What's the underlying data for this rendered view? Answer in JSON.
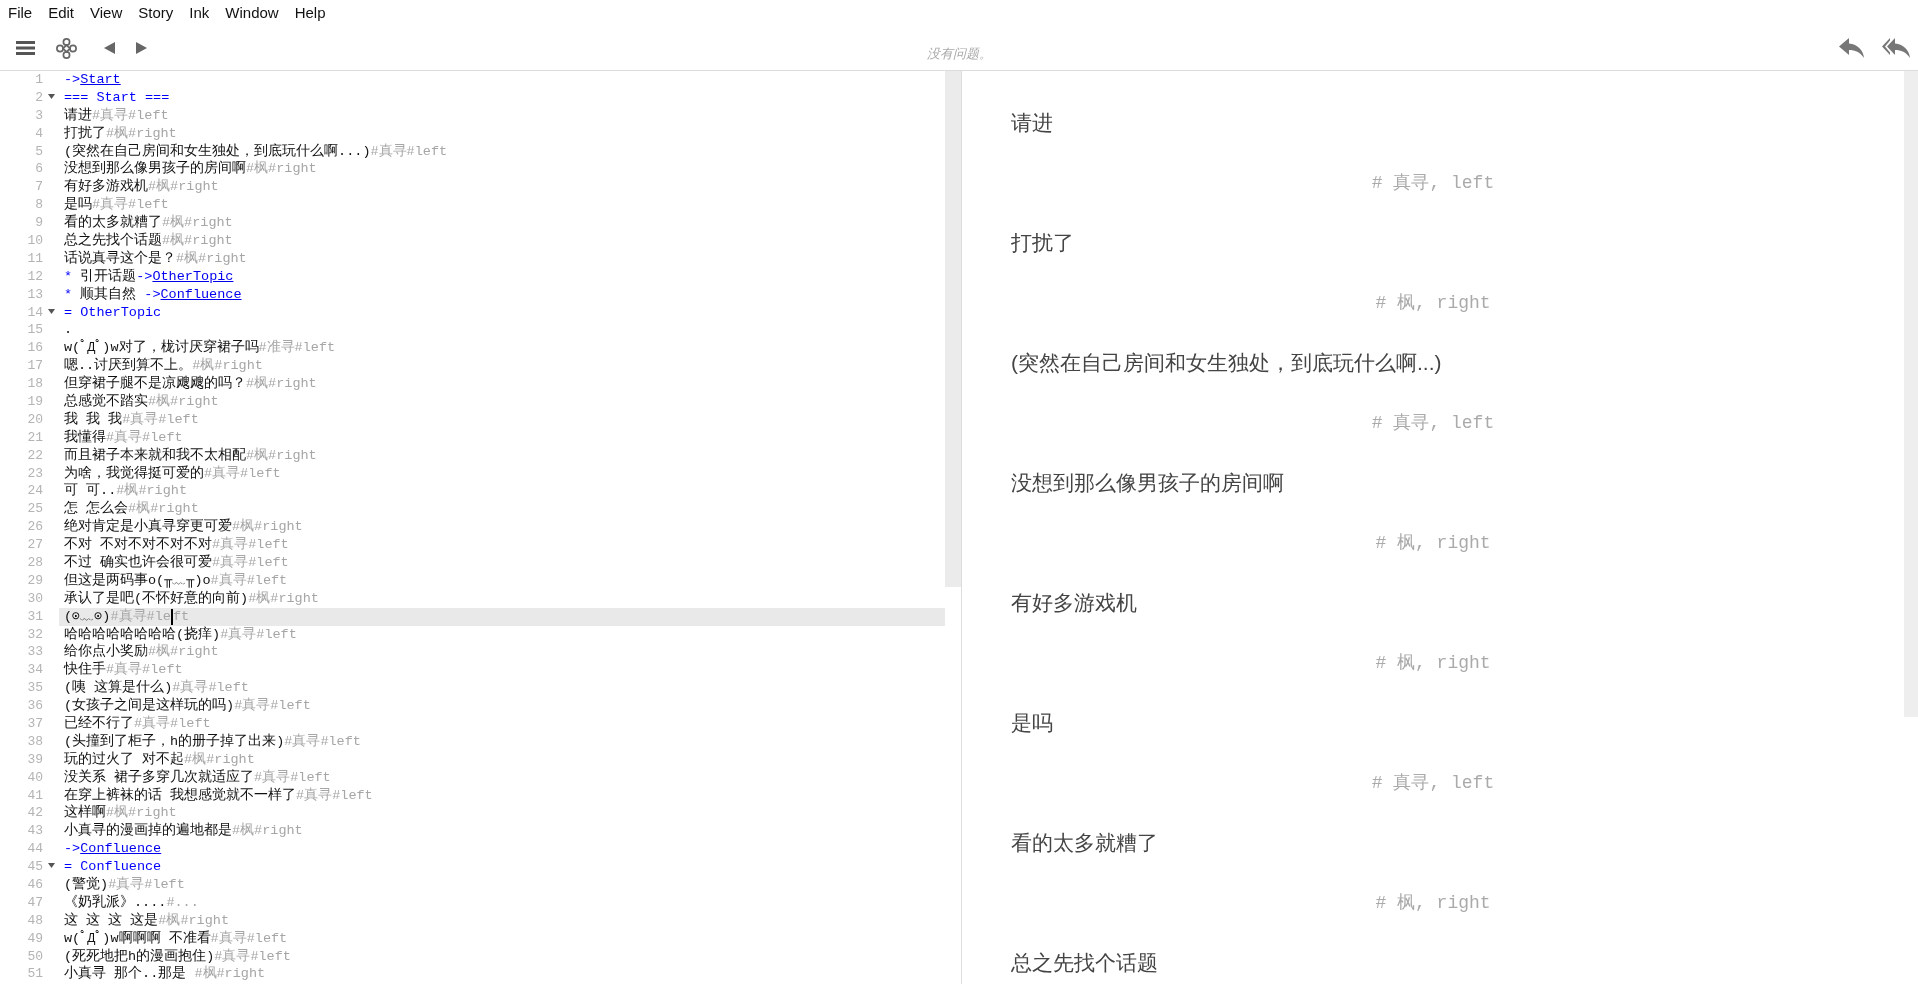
{
  "menu_bar": [
    "File",
    "Edit",
    "View",
    "Story",
    "Ink",
    "Window",
    "Help"
  ],
  "toolbar": {
    "status": "没有问题。"
  },
  "editor": {
    "lines": [
      {
        "number": "1",
        "foldable": false,
        "active": false,
        "segments": [
          {
            "kind": "divert",
            "text": "->"
          },
          {
            "kind": "link",
            "text": "Start"
          }
        ]
      },
      {
        "number": "2",
        "foldable": true,
        "active": false,
        "segments": [
          {
            "kind": "heading",
            "text": "=== Start ==="
          }
        ]
      },
      {
        "number": "3",
        "foldable": false,
        "active": false,
        "segments": [
          {
            "kind": "text",
            "text": "请进"
          },
          {
            "kind": "tag",
            "text": "#真寻#left"
          }
        ]
      },
      {
        "number": "4",
        "foldable": false,
        "active": false,
        "segments": [
          {
            "kind": "text",
            "text": "打扰了"
          },
          {
            "kind": "tag",
            "text": "#枫#right"
          }
        ]
      },
      {
        "number": "5",
        "foldable": false,
        "active": false,
        "segments": [
          {
            "kind": "text",
            "text": "(突然在自己房间和女生独处，到底玩什么啊...)"
          },
          {
            "kind": "tag",
            "text": "#真寻#left"
          }
        ]
      },
      {
        "number": "6",
        "foldable": false,
        "active": false,
        "segments": [
          {
            "kind": "text",
            "text": "没想到那么像男孩子的房间啊"
          },
          {
            "kind": "tag",
            "text": "#枫#right"
          }
        ]
      },
      {
        "number": "7",
        "foldable": false,
        "active": false,
        "segments": [
          {
            "kind": "text",
            "text": "有好多游戏机"
          },
          {
            "kind": "tag",
            "text": "#枫#right"
          }
        ]
      },
      {
        "number": "8",
        "foldable": false,
        "active": false,
        "segments": [
          {
            "kind": "text",
            "text": "是吗"
          },
          {
            "kind": "tag",
            "text": "#真寻#left"
          }
        ]
      },
      {
        "number": "9",
        "foldable": false,
        "active": false,
        "segments": [
          {
            "kind": "text",
            "text": "看的太多就糟了"
          },
          {
            "kind": "tag",
            "text": "#枫#right"
          }
        ]
      },
      {
        "number": "10",
        "foldable": false,
        "active": false,
        "segments": [
          {
            "kind": "text",
            "text": "总之先找个话题"
          },
          {
            "kind": "tag",
            "text": "#枫#right"
          }
        ]
      },
      {
        "number": "11",
        "foldable": false,
        "active": false,
        "segments": [
          {
            "kind": "text",
            "text": "话说真寻这个是？"
          },
          {
            "kind": "tag",
            "text": "#枫#right"
          }
        ]
      },
      {
        "number": "12",
        "foldable": false,
        "active": false,
        "segments": [
          {
            "kind": "choice",
            "text": "*"
          },
          {
            "kind": "text",
            "text": " 引开话题"
          },
          {
            "kind": "divert",
            "text": "->"
          },
          {
            "kind": "link",
            "text": "OtherTopic"
          }
        ]
      },
      {
        "number": "13",
        "foldable": false,
        "active": false,
        "segments": [
          {
            "kind": "choice",
            "text": "*"
          },
          {
            "kind": "text",
            "text": " 顺其自然 "
          },
          {
            "kind": "divert",
            "text": "->"
          },
          {
            "kind": "link",
            "text": "Confluence"
          }
        ]
      },
      {
        "number": "14",
        "foldable": true,
        "active": false,
        "segments": [
          {
            "kind": "heading",
            "text": "= OtherTopic"
          }
        ]
      },
      {
        "number": "15",
        "foldable": false,
        "active": false,
        "segments": [
          {
            "kind": "text",
            "text": "."
          }
        ]
      },
      {
        "number": "16",
        "foldable": false,
        "active": false,
        "segments": [
          {
            "kind": "text",
            "text": "w(ﾟДﾟ)w对了，栊讨厌穿裙子吗"
          },
          {
            "kind": "tag",
            "text": "#准寻#left"
          }
        ]
      },
      {
        "number": "17",
        "foldable": false,
        "active": false,
        "segments": [
          {
            "kind": "text",
            "text": "嗯..讨厌到算不上。"
          },
          {
            "kind": "tag",
            "text": "#枫#right"
          }
        ]
      },
      {
        "number": "18",
        "foldable": false,
        "active": false,
        "segments": [
          {
            "kind": "text",
            "text": "但穿裙子腿不是凉飕飕的吗？"
          },
          {
            "kind": "tag",
            "text": "#枫#right"
          }
        ]
      },
      {
        "number": "19",
        "foldable": false,
        "active": false,
        "segments": [
          {
            "kind": "text",
            "text": "总感觉不踏实"
          },
          {
            "kind": "tag",
            "text": "#枫#right"
          }
        ]
      },
      {
        "number": "20",
        "foldable": false,
        "active": false,
        "segments": [
          {
            "kind": "text",
            "text": "我 我 我"
          },
          {
            "kind": "tag",
            "text": "#真寻#left"
          }
        ]
      },
      {
        "number": "21",
        "foldable": false,
        "active": false,
        "segments": [
          {
            "kind": "text",
            "text": "我懂得"
          },
          {
            "kind": "tag",
            "text": "#真寻#left"
          }
        ]
      },
      {
        "number": "22",
        "foldable": false,
        "active": false,
        "segments": [
          {
            "kind": "text",
            "text": "而且裙子本来就和我不太相配"
          },
          {
            "kind": "tag",
            "text": "#枫#right"
          }
        ]
      },
      {
        "number": "23",
        "foldable": false,
        "active": false,
        "segments": [
          {
            "kind": "text",
            "text": "为啥，我觉得挺可爱的"
          },
          {
            "kind": "tag",
            "text": "#真寻#left"
          }
        ]
      },
      {
        "number": "24",
        "foldable": false,
        "active": false,
        "segments": [
          {
            "kind": "text",
            "text": "可 可.."
          },
          {
            "kind": "tag",
            "text": "#枫#right"
          }
        ]
      },
      {
        "number": "25",
        "foldable": false,
        "active": false,
        "segments": [
          {
            "kind": "text",
            "text": "怎 怎么会"
          },
          {
            "kind": "tag",
            "text": "#枫#right"
          }
        ]
      },
      {
        "number": "26",
        "foldable": false,
        "active": false,
        "segments": [
          {
            "kind": "text",
            "text": "绝对肯定是小真寻穿更可爱"
          },
          {
            "kind": "tag",
            "text": "#枫#right"
          }
        ]
      },
      {
        "number": "27",
        "foldable": false,
        "active": false,
        "segments": [
          {
            "kind": "text",
            "text": "不对 不对不对不对不对"
          },
          {
            "kind": "tag",
            "text": "#真寻#left"
          }
        ]
      },
      {
        "number": "28",
        "foldable": false,
        "active": false,
        "segments": [
          {
            "kind": "text",
            "text": "不过 确实也许会很可爱"
          },
          {
            "kind": "tag",
            "text": "#真寻#left"
          }
        ]
      },
      {
        "number": "29",
        "foldable": false,
        "active": false,
        "segments": [
          {
            "kind": "text",
            "text": "但这是两码事o(╥﹏╥)o"
          },
          {
            "kind": "tag",
            "text": "#真寻#left"
          }
        ]
      },
      {
        "number": "30",
        "foldable": false,
        "active": false,
        "segments": [
          {
            "kind": "text",
            "text": "承认了是吧(不怀好意的向前)"
          },
          {
            "kind": "tag",
            "text": "#枫#right"
          }
        ]
      },
      {
        "number": "31",
        "foldable": false,
        "active": true,
        "segments": [
          {
            "kind": "text",
            "text": "(⊙﹏⊙)"
          },
          {
            "kind": "tag",
            "text": "#真寻#le"
          },
          {
            "kind": "cursor"
          },
          {
            "kind": "tag",
            "text": "ft"
          }
        ]
      },
      {
        "number": "32",
        "foldable": false,
        "active": false,
        "segments": [
          {
            "kind": "text",
            "text": "哈哈哈哈哈哈哈哈(挠痒)"
          },
          {
            "kind": "tag",
            "text": "#真寻#left"
          }
        ]
      },
      {
        "number": "33",
        "foldable": false,
        "active": false,
        "segments": [
          {
            "kind": "text",
            "text": "给你点小奖励"
          },
          {
            "kind": "tag",
            "text": "#枫#right"
          }
        ]
      },
      {
        "number": "34",
        "foldable": false,
        "active": false,
        "segments": [
          {
            "kind": "text",
            "text": "快住手"
          },
          {
            "kind": "tag",
            "text": "#真寻#left"
          }
        ]
      },
      {
        "number": "35",
        "foldable": false,
        "active": false,
        "segments": [
          {
            "kind": "text",
            "text": "(咦 这算是什么)"
          },
          {
            "kind": "tag",
            "text": "#真寻#left"
          }
        ]
      },
      {
        "number": "36",
        "foldable": false,
        "active": false,
        "segments": [
          {
            "kind": "text",
            "text": "(女孩子之间是这样玩的吗)"
          },
          {
            "kind": "tag",
            "text": "#真寻#left"
          }
        ]
      },
      {
        "number": "37",
        "foldable": false,
        "active": false,
        "segments": [
          {
            "kind": "text",
            "text": "已经不行了"
          },
          {
            "kind": "tag",
            "text": "#真寻#left"
          }
        ]
      },
      {
        "number": "38",
        "foldable": false,
        "active": false,
        "segments": [
          {
            "kind": "text",
            "text": "(头撞到了柜子，h的册子掉了出来)"
          },
          {
            "kind": "tag",
            "text": "#真寻#left"
          }
        ]
      },
      {
        "number": "39",
        "foldable": false,
        "active": false,
        "segments": [
          {
            "kind": "text",
            "text": "玩的过火了 对不起"
          },
          {
            "kind": "tag",
            "text": "#枫#right"
          }
        ]
      },
      {
        "number": "40",
        "foldable": false,
        "active": false,
        "segments": [
          {
            "kind": "text",
            "text": "没关系 裙子多穿几次就适应了"
          },
          {
            "kind": "tag",
            "text": "#真寻#left"
          }
        ]
      },
      {
        "number": "41",
        "foldable": false,
        "active": false,
        "segments": [
          {
            "kind": "text",
            "text": "在穿上裤袜的话 我想感觉就不一样了"
          },
          {
            "kind": "tag",
            "text": "#真寻#left"
          }
        ]
      },
      {
        "number": "42",
        "foldable": false,
        "active": false,
        "segments": [
          {
            "kind": "text",
            "text": "这样啊"
          },
          {
            "kind": "tag",
            "text": "#枫#right"
          }
        ]
      },
      {
        "number": "43",
        "foldable": false,
        "active": false,
        "segments": [
          {
            "kind": "text",
            "text": "小真寻的漫画掉的遍地都是"
          },
          {
            "kind": "tag",
            "text": "#枫#right"
          }
        ]
      },
      {
        "number": "44",
        "foldable": false,
        "active": false,
        "segments": [
          {
            "kind": "divert",
            "text": "->"
          },
          {
            "kind": "link",
            "text": "Confluence"
          }
        ]
      },
      {
        "number": "45",
        "foldable": true,
        "active": false,
        "segments": [
          {
            "kind": "heading",
            "text": "= Confluence"
          }
        ]
      },
      {
        "number": "46",
        "foldable": false,
        "active": false,
        "segments": [
          {
            "kind": "text",
            "text": "(警觉)"
          },
          {
            "kind": "tag",
            "text": "#真寻#left"
          }
        ]
      },
      {
        "number": "47",
        "foldable": false,
        "active": false,
        "segments": [
          {
            "kind": "text",
            "text": "《奶乳派》...."
          },
          {
            "kind": "tag",
            "text": "#..."
          }
        ]
      },
      {
        "number": "48",
        "foldable": false,
        "active": false,
        "segments": [
          {
            "kind": "text",
            "text": "这 这 这 这是"
          },
          {
            "kind": "tag",
            "text": "#枫#right"
          }
        ]
      },
      {
        "number": "49",
        "foldable": false,
        "active": false,
        "segments": [
          {
            "kind": "text",
            "text": "w(ﾟДﾟ)w啊啊啊 不准看"
          },
          {
            "kind": "tag",
            "text": "#真寻#left"
          }
        ]
      },
      {
        "number": "50",
        "foldable": false,
        "active": false,
        "segments": [
          {
            "kind": "text",
            "text": "(死死地把h的漫画抱住)"
          },
          {
            "kind": "tag",
            "text": "#真寻#left"
          }
        ]
      },
      {
        "number": "51",
        "foldable": false,
        "active": false,
        "segments": [
          {
            "kind": "text",
            "text": "小真寻 那个..那是 "
          },
          {
            "kind": "tag",
            "text": "#枫#right"
          }
        ]
      }
    ]
  },
  "preview": {
    "blocks": [
      {
        "kind": "paragraph",
        "text": "请进"
      },
      {
        "kind": "tags",
        "text": "# 真寻, left"
      },
      {
        "kind": "paragraph",
        "text": "打扰了"
      },
      {
        "kind": "tags",
        "text": "# 枫, right"
      },
      {
        "kind": "paragraph",
        "text": "(突然在自己房间和女生独处，到底玩什么啊...)"
      },
      {
        "kind": "tags",
        "text": "# 真寻, left"
      },
      {
        "kind": "paragraph",
        "text": "没想到那么像男孩子的房间啊"
      },
      {
        "kind": "tags",
        "text": "# 枫, right"
      },
      {
        "kind": "paragraph",
        "text": "有好多游戏机"
      },
      {
        "kind": "tags",
        "text": "# 枫, right"
      },
      {
        "kind": "paragraph",
        "text": "是吗"
      },
      {
        "kind": "tags",
        "text": "# 真寻, left"
      },
      {
        "kind": "paragraph",
        "text": "看的太多就糟了"
      },
      {
        "kind": "tags",
        "text": "# 枫, right"
      },
      {
        "kind": "paragraph",
        "text": "总之先找个话题"
      }
    ]
  }
}
